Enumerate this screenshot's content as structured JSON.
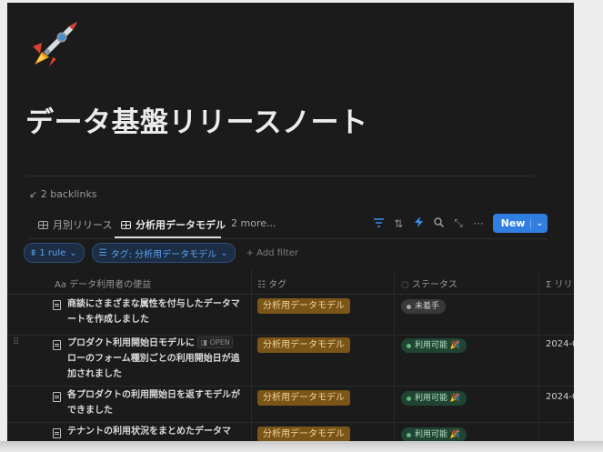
{
  "page": {
    "title": "データ基盤リリースノート",
    "backlinks": "2 backlinks"
  },
  "tabs": [
    {
      "label": "月別リリース"
    },
    {
      "label": "分析用データモデル"
    },
    {
      "label": "2 more..."
    }
  ],
  "toolbar": {
    "new_label": "New",
    "icons": [
      "filter-icon",
      "sort-icon",
      "automation-icon",
      "search-icon",
      "expand-icon",
      "more-icon"
    ]
  },
  "filters": {
    "rule_label": "1 rule",
    "tag_filter_label": "タグ: 分析用データモデル",
    "add_filter_label": "Add filter"
  },
  "columns": {
    "name": "データ利用者の便益",
    "tag": "タグ",
    "status": "ステータス",
    "release": "リリ"
  },
  "rows": [
    {
      "name": "商談にさまざまな属性を付与したデータマートを作成しました",
      "tag": "分析用データモデル",
      "status": "未着手",
      "status_kind": "grey",
      "date": ""
    },
    {
      "name": "プロダクト利用開始日モデルに",
      "open": "OPEN",
      "name_rest": "ローのフォーム種別ごとの利用開始日が追加されました",
      "tag": "分析用データモデル",
      "status": "利用可能 🎉",
      "status_kind": "green",
      "date": "2024-0"
    },
    {
      "name": "各プロダクトの利用開始日を返すモデルができました",
      "tag": "分析用データモデル",
      "status": "利用可能 🎉",
      "status_kind": "green",
      "date": "2024-0"
    },
    {
      "name": "テナントの利用状況をまとめたデータマ",
      "tag": "分析用データモデル",
      "status": "利用可能 🎉",
      "status_kind": "green",
      "date": ""
    }
  ],
  "colors": {
    "background": "#1b1b1b",
    "accent": "#2f7ee0",
    "tag": "#7a5518",
    "status_green": "#1f4433",
    "status_grey": "#393939"
  }
}
